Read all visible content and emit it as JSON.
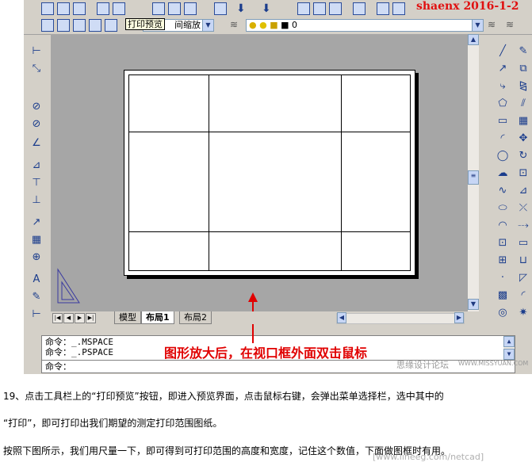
{
  "toolbar": {
    "overlay_text": "shaenx 2016-1-2",
    "tooltip": "打印预览",
    "zoom_dropdown": "间缩放",
    "layer_value": "0"
  },
  "tabs": [
    {
      "label": "模型"
    },
    {
      "label": "布局1"
    },
    {
      "label": "布局2"
    }
  ],
  "command_lines": [
    "命令：_.MSPACE",
    "命令：_.PSPACE",
    "命令："
  ],
  "annotation": "图形放大后，在视口框外面双击鼠标",
  "watermark_forum": "思缘设计论坛",
  "watermark_site": "WWW.MISSYUAN.COM",
  "watermark_bottom": "[www.lineeg.com/netcad]",
  "paragraphs": [
    "19、点击工具栏上的“打印预览”按钮，即进入预览界面，点击鼠标右键，会弹出菜单选择栏，选中其中的",
    "“打印”，即可打印出我们期望的测定打印范围图纸。",
    "按照下图所示，我们用尺量一下，即可得到可打印范围的高度和宽度，记住这个数值，下面做图框时有用。"
  ],
  "colors": {
    "annotation": "#e00000",
    "canvas": "#a6a6a6",
    "ui_face": "#d4d0c8"
  }
}
